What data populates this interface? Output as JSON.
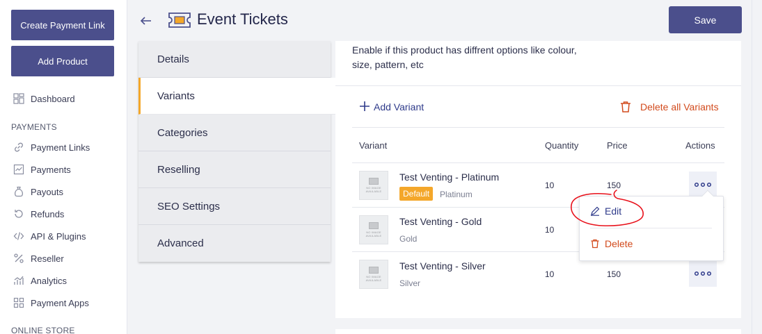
{
  "sidebar": {
    "create_payment_link": "Create Payment Link",
    "add_product": "Add Product",
    "dashboard": "Dashboard",
    "section_payments": "PAYMENTS",
    "items": [
      {
        "label": "Payment Links",
        "icon": "link-icon"
      },
      {
        "label": "Payments",
        "icon": "chart-icon"
      },
      {
        "label": "Payouts",
        "icon": "money-bag-icon"
      },
      {
        "label": "Refunds",
        "icon": "refund-icon"
      },
      {
        "label": "API & Plugins",
        "icon": "code-icon"
      },
      {
        "label": "Reseller",
        "icon": "percent-icon"
      },
      {
        "label": "Analytics",
        "icon": "analytics-icon"
      },
      {
        "label": "Payment Apps",
        "icon": "apps-icon"
      }
    ],
    "section_online_store": "ONLINE STORE"
  },
  "header": {
    "title": "Event Tickets",
    "save_label": "Save"
  },
  "tabs": [
    "Details",
    "Variants",
    "Categories",
    "Reselling",
    "SEO Settings",
    "Advanced"
  ],
  "active_tab": "Variants",
  "main": {
    "description": "Enable if this product has diffrent options like colour, size, pattern, etc",
    "add_variant": "Add Variant",
    "delete_all": "Delete all Variants",
    "columns": {
      "variant": "Variant",
      "quantity": "Quantity",
      "price": "Price",
      "actions": "Actions"
    },
    "no_image": "NO IMAGE AVAILABLE",
    "default_badge": "Default",
    "variants": [
      {
        "name": "Test Venting - Platinum",
        "option": "Platinum",
        "quantity": "10",
        "price": "150"
      },
      {
        "name": "Test Venting - Gold",
        "option": "Gold",
        "quantity": "10",
        "price": ""
      },
      {
        "name": "Test Venting - Silver",
        "option": "Silver",
        "quantity": "10",
        "price": "150"
      }
    ]
  },
  "menu": {
    "edit": "Edit",
    "delete": "Delete"
  },
  "colors": {
    "primary": "#4b4f8c",
    "accent": "#f4a72a",
    "danger": "#d24a1c",
    "annotation": "#e8101a"
  }
}
